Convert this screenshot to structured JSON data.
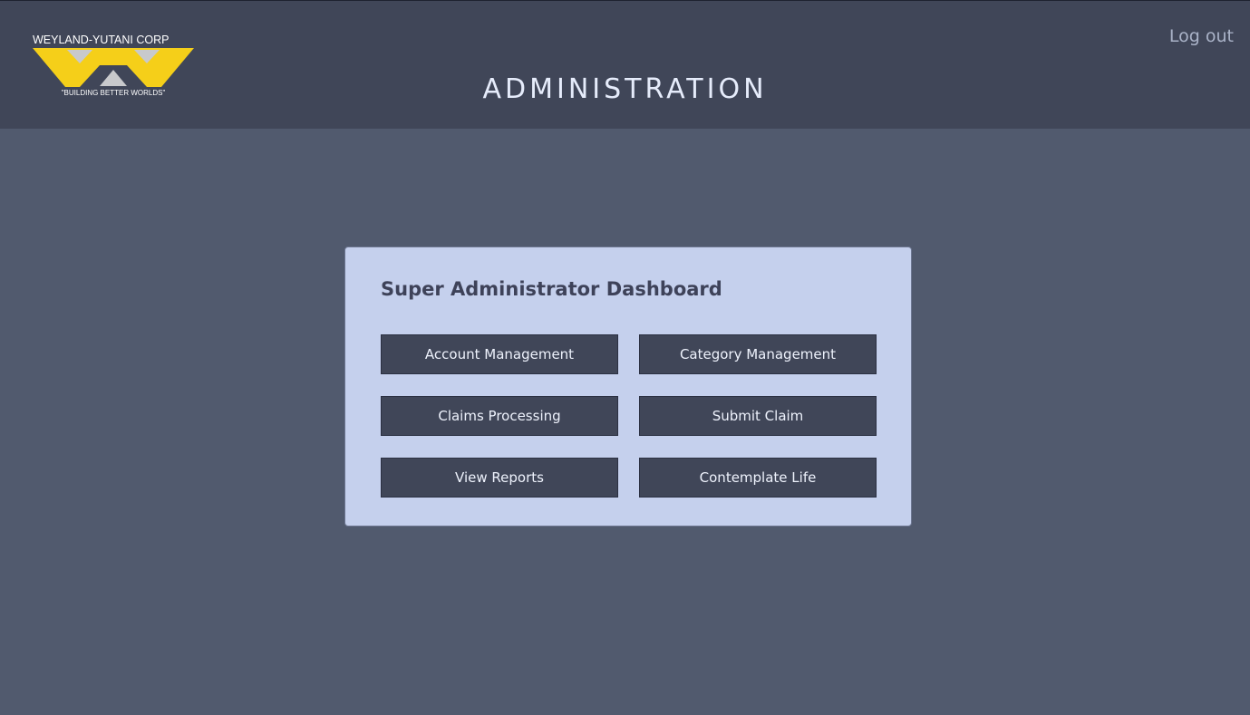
{
  "header": {
    "logo": {
      "company": "WEYLAND-YUTANI CORP",
      "tagline": "\"BUILDING BETTER WORLDS\"",
      "colors": {
        "yellow": "#f5cf19",
        "grey": "#c8c9cc"
      }
    },
    "title": "ADMINISTRATION",
    "logout_label": "Log out"
  },
  "dashboard": {
    "title": "Super Administrator Dashboard",
    "buttons": [
      {
        "label": "Account Management"
      },
      {
        "label": "Category Management"
      },
      {
        "label": "Claims Processing"
      },
      {
        "label": "Submit Claim"
      },
      {
        "label": "View Reports"
      },
      {
        "label": "Contemplate Life"
      }
    ]
  },
  "colors": {
    "header_bg": "#404658",
    "page_bg": "#515a6e",
    "card_bg": "#c5d0ed",
    "button_bg": "#404658",
    "title_text": "#e6ecfb"
  }
}
